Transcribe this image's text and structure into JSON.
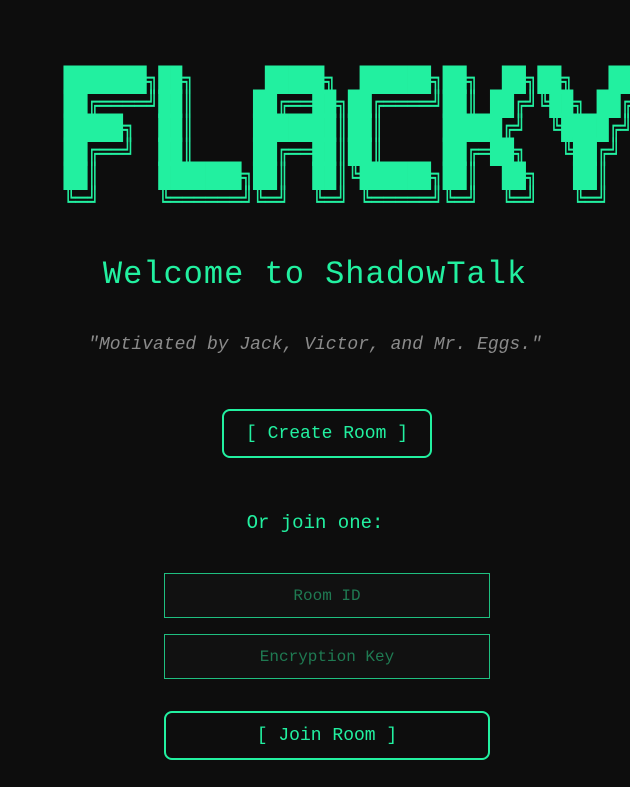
{
  "app": {
    "logo_ascii": "███████╗██╗      █████╗  ██████╗██╗  ██╗██╗   ██╗\n██╔════╝██║     ██╔══██╗██╔════╝██║ ██╔╝╚██╗ ██╔╝\n█████╗  ██║     ███████║██║     █████╔╝  ╚████╔╝ \n██╔══╝  ██║     ██╔══██║██║     ██╔═██╗   ╚██╔╝  \n██║     ███████╗██║  ██║╚██████╗██║  ██╗   ██║   \n╚═╝     ╚══════╝╚═╝  ╚═╝ ╚═════╝╚═╝  ╚═╝   ╚═╝   ",
    "title": "Welcome to ShadowTalk",
    "quote": "\"Motivated by Jack, Victor, and Mr. Eggs.\""
  },
  "actions": {
    "create_label": "[ Create Room ]",
    "or_join_label": "Or join one:",
    "join_label": "[ Join Room ]"
  },
  "fields": {
    "room_id": {
      "placeholder": "Room ID",
      "value": ""
    },
    "encryption_key": {
      "placeholder": "Encryption Key",
      "value": ""
    }
  },
  "colors": {
    "background": "#0d0d0d",
    "accent": "#22f0a0",
    "muted_text": "#8a8a8a",
    "placeholder": "#1f7a52"
  }
}
